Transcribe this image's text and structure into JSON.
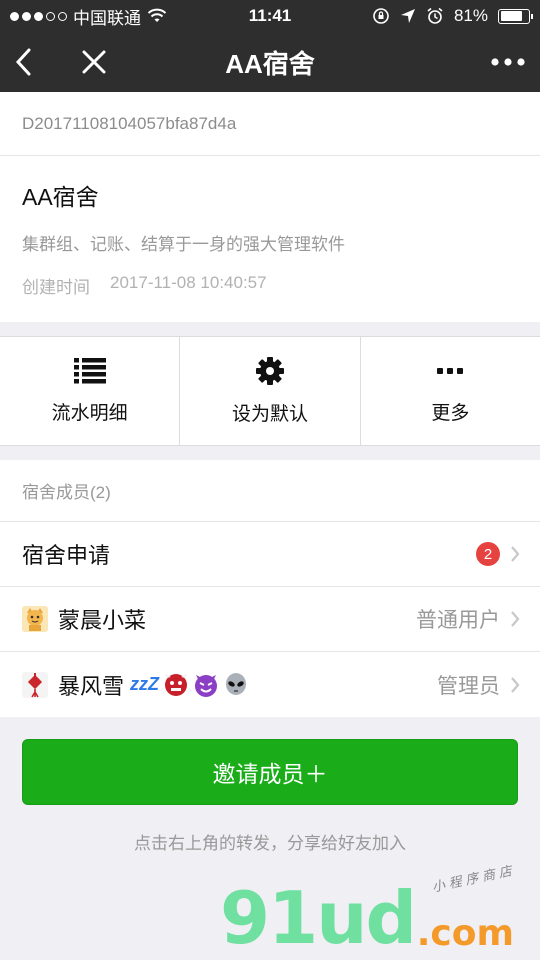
{
  "status_bar": {
    "carrier": "中国联通",
    "time": "11:41",
    "battery": "81%",
    "battery_level": 0.81
  },
  "nav": {
    "title": "AA宿舍",
    "back_icon": "chevron-left-icon",
    "close_icon": "close-icon",
    "more_icon": "more-dots-icon"
  },
  "dorm": {
    "id": "D20171108104057bfa87d4a",
    "name": "AA宿舍",
    "description": "集群组、记账、结算于一身的强大管理软件",
    "created_label": "创建时间",
    "created_value": "2017-11-08 10:40:57"
  },
  "actions": [
    {
      "label": "流水明细",
      "icon": "list-icon"
    },
    {
      "label": "设为默认",
      "icon": "gear-icon"
    },
    {
      "label": "更多",
      "icon": "more-dots-icon"
    }
  ],
  "members": {
    "header": "宿舍成员(2)",
    "application": {
      "label": "宿舍申请",
      "badge": "2"
    },
    "list": [
      {
        "name": "蒙晨小菜",
        "role": "普通用户"
      },
      {
        "name": "暴风雪",
        "suffix": "zzZ",
        "role": "管理员"
      }
    ]
  },
  "invite": {
    "button": "邀请成员＋",
    "hint": "点击右上角的转发，分享给好友加入"
  },
  "watermark": {
    "main": "91ud",
    "domain": ".com",
    "tagline": "小程序商店"
  },
  "colors": {
    "nav_bg": "#2e2e2e",
    "primary_green": "#1aad19",
    "badge_red": "#e64340"
  }
}
